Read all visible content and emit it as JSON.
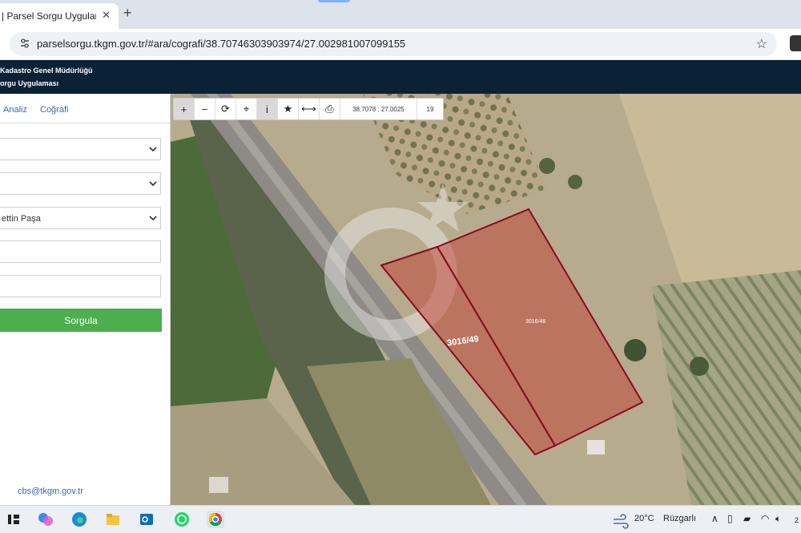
{
  "browser": {
    "tab_title": "| Parsel Sorgu Uygulaması",
    "tab_close": "✕",
    "new_tab": "+",
    "url": "parselsorgu.tkgm.gov.tr/#ara/cografi/38.70746303903974/27.002981007099155"
  },
  "app": {
    "header_line1": "Kadastro Genel Müdürlüğü",
    "header_line2": "orgu Uygulaması",
    "tabs": [
      {
        "label": "Analiz"
      },
      {
        "label": "Coğrafi"
      }
    ],
    "fields": [
      {
        "value": ""
      },
      {
        "value": ""
      },
      {
        "value": "ettin Paşa"
      },
      {
        "value": ""
      },
      {
        "value": ""
      }
    ],
    "query_button": "Sorgula",
    "contact_email": "cbs@tkgm.gov.tr"
  },
  "map": {
    "coordinate_readout": "38.7078 : 27.0025",
    "zoom_level": "19",
    "parcels": [
      {
        "label": "3016/49"
      },
      {
        "label": "3016/48"
      }
    ],
    "tools": [
      "zoom-in-icon",
      "zoom-out-icon",
      "refresh-icon",
      "locate-icon",
      "info-icon",
      "favorite-icon",
      "measure-icon",
      "print-icon"
    ]
  },
  "taskbar": {
    "temperature": "20°C",
    "weather_text": "Rüzgarlı",
    "clock_partial": "2"
  },
  "colors": {
    "header_bg": "#0b2136",
    "button_green": "#4cae4c",
    "parcel_fill": "#c0392b",
    "parcel_stroke": "#8b0a1e",
    "link_blue": "#2f6db3"
  }
}
